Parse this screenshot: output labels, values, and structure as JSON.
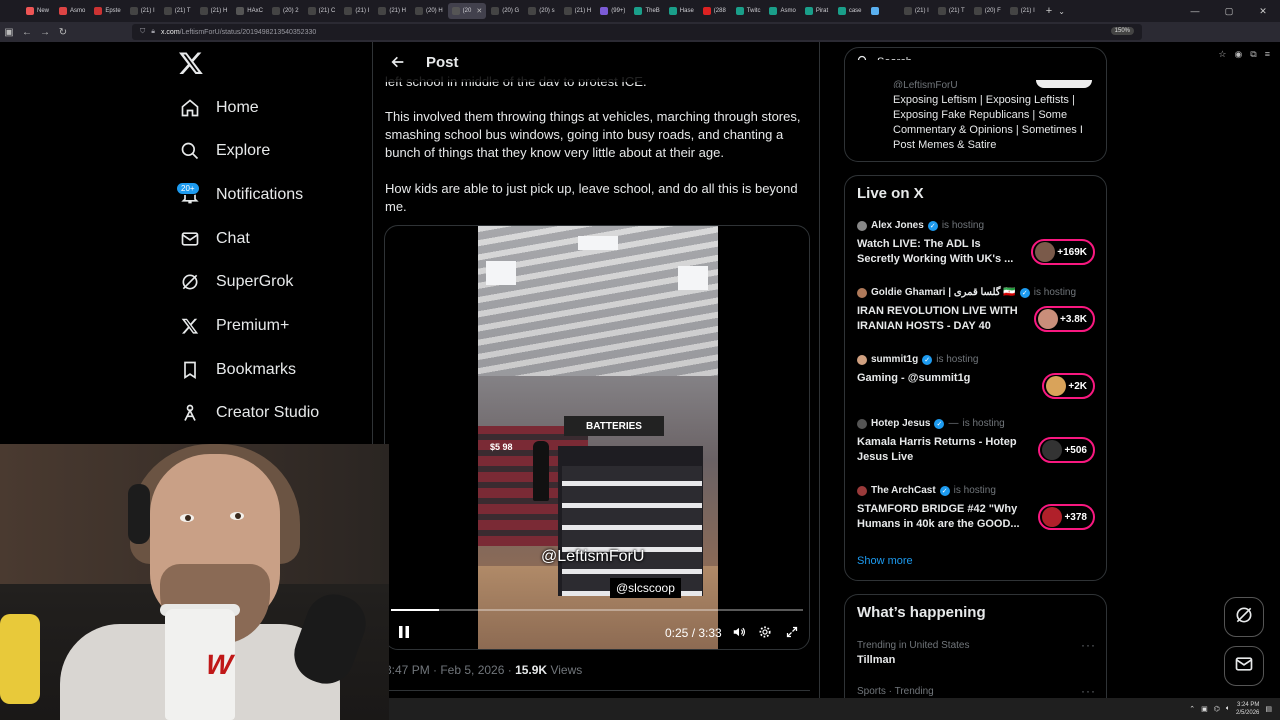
{
  "browser": {
    "tabs": [
      {
        "label": "New"
      },
      {
        "label": "Asmo"
      },
      {
        "label": "Epste"
      },
      {
        "label": "(21) I"
      },
      {
        "label": "(21) T"
      },
      {
        "label": "(21) H"
      },
      {
        "label": "HAxC"
      },
      {
        "label": "(20) 2"
      },
      {
        "label": "(21) C"
      },
      {
        "label": "(21) I"
      },
      {
        "label": "(21) H"
      },
      {
        "label": "(20) H"
      },
      {
        "label": "(20",
        "active": true
      },
      {
        "label": "(20) G"
      },
      {
        "label": "(20) s"
      },
      {
        "label": "(21) H"
      },
      {
        "label": "(99+)"
      },
      {
        "label": "TheB"
      },
      {
        "label": "Hase"
      },
      {
        "label": "(288"
      },
      {
        "label": "Twitc"
      },
      {
        "label": "Asmo"
      },
      {
        "label": "Pirat"
      },
      {
        "label": "case"
      },
      {
        "label": ""
      },
      {
        "label": "(21) I"
      },
      {
        "label": "(21) T"
      },
      {
        "label": "(20) F"
      },
      {
        "label": "(21) I"
      }
    ],
    "url_domain": "x.com",
    "url_path": "/LeftismForU/status/2019498213540352330",
    "zoom": "150%"
  },
  "nav": {
    "home": "Home",
    "explore": "Explore",
    "notifications": "Notifications",
    "notifications_badge": "20+",
    "chat": "Chat",
    "supergrok": "SuperGrok",
    "premium": "Premium+",
    "bookmarks": "Bookmarks",
    "creator_studio": "Creator Studio"
  },
  "post": {
    "header_title": "Post",
    "text_cut": "left school in middle of the day to protest ICE.",
    "paragraph_1": "This involved them throwing things at vehicles, marching through stores, smashing school bus windows, going into busy roads, and chanting a bunch of things that they know very little about at their age.",
    "paragraph_2": "How kids are able to just pick up, leave school, and do all this is beyond me.",
    "video": {
      "sign_text": "BATTERIES",
      "price_text": "$5 98",
      "watermark_1": "@LeftismForU",
      "watermark_2": "@slcscoop",
      "time_current": "0:25",
      "time_total": "3:33",
      "progress": 0.117
    },
    "timestamp": "3:47 PM · Feb 5, 2026",
    "views_count": "15.9K",
    "views_label": "Views"
  },
  "sidebar": {
    "search_placeholder": "Search",
    "profile_handle": "@LeftismForU",
    "profile_bio": "Exposing Leftism | Exposing Leftists | Exposing Fake Republicans | Some Commentary & Opinions | Sometimes I Post Memes & Satire",
    "live_title": "Live on X",
    "hosting_label": "is hosting",
    "live_items": [
      {
        "host": "Alex Jones",
        "title": "Watch LIVE: The ADL Is Secretly Working With UK's ...",
        "count": "+169K"
      },
      {
        "host": "Goldie Ghamari | گلسا قمری 🇮🇷",
        "title": "IRAN REVOLUTION LIVE WITH IRANIAN HOSTS - DAY 40",
        "count": "+3.8K"
      },
      {
        "host": "summit1g",
        "title": "Gaming - @summit1g",
        "count": "+2K"
      },
      {
        "host": "Hotep Jesus",
        "title": "Kamala Harris Returns - Hotep Jesus Live",
        "count": "+506",
        "separator": "—"
      },
      {
        "host": "The ArchCast",
        "title": "STAMFORD BRIDGE #42 \"Why Humans in 40k are the GOOD...",
        "count": "+378"
      }
    ],
    "show_more": "Show more",
    "whats_happening": "What’s happening",
    "trends": [
      {
        "label": "Trending in United States",
        "name": "Tillman"
      },
      {
        "label": "Sports · Trending",
        "name": ""
      }
    ]
  },
  "taskbar": {
    "time": "3:24 PM",
    "date": "2/5/2026"
  },
  "colors": {
    "accent": "#1d9bf0",
    "live_ring": "#f91880",
    "border": "#2f3336",
    "muted": "#71767b"
  }
}
